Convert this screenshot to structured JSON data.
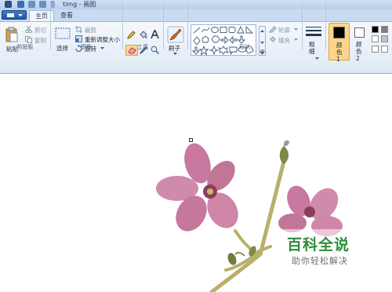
{
  "window": {
    "title": "timg - 画图"
  },
  "tabs": [
    {
      "label": "主页"
    },
    {
      "label": "查看"
    }
  ],
  "ribbon": {
    "clipboard": {
      "group": "剪贴板",
      "paste": "粘贴",
      "cut": "剪切",
      "copy": "复制"
    },
    "image": {
      "group": "图像",
      "select": "选择",
      "crop": "裁剪",
      "resize": "重新调整大小",
      "rotate": "旋转"
    },
    "tools": {
      "group": "工具"
    },
    "brushes": {
      "label": "刷子"
    },
    "shapes": {
      "group": "形状",
      "outline": "轮廓",
      "fill": "填充"
    },
    "size": {
      "label": "粗细"
    },
    "color1": {
      "label": "颜色 1",
      "value": "#000000"
    },
    "color2": {
      "label": "颜色 2",
      "value": "#ffffff"
    }
  },
  "palette": [
    "#000000",
    "#7f7f7f",
    "#ffffff",
    "#c3c3c3",
    "#ffffff",
    "#ffffff"
  ],
  "watermark": {
    "title": "百科全说",
    "subtitle": "助你轻松解决"
  }
}
